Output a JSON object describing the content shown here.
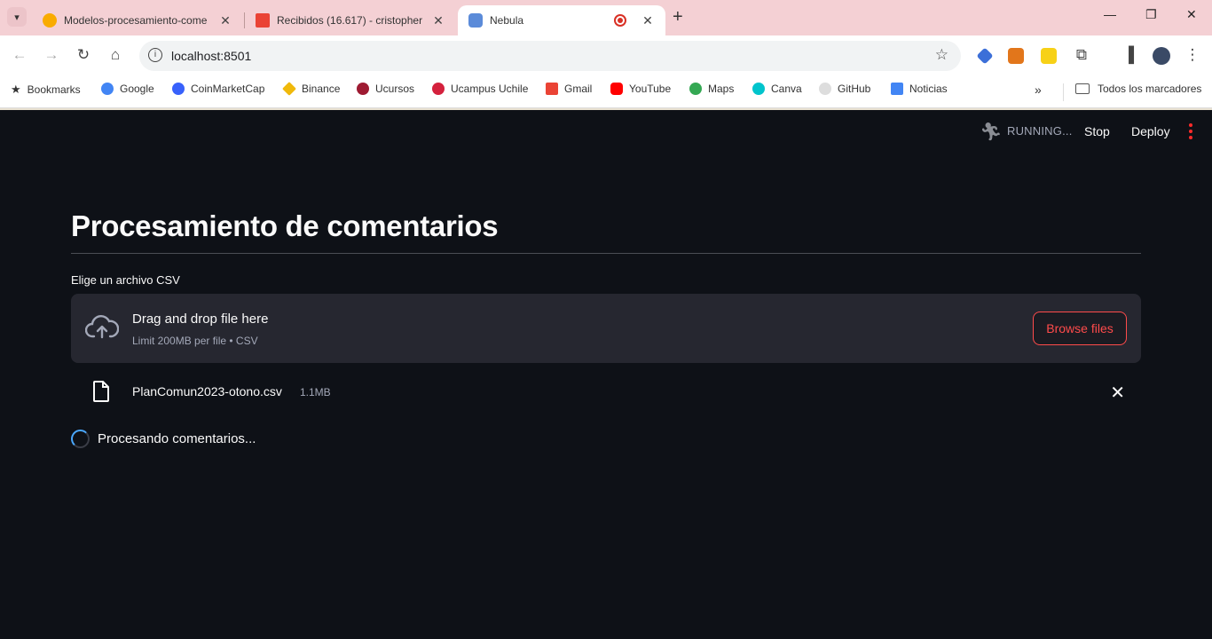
{
  "browser": {
    "tabs": [
      {
        "title": "Modelos-procesamiento-come",
        "favicon": "colab-icon"
      },
      {
        "title": "Recibidos (16.617) - cristopher",
        "favicon": "gmail-icon"
      },
      {
        "title": "Nebula",
        "favicon": "nebula-icon",
        "active": true
      }
    ],
    "url": "localhost:8501",
    "bookmarks": [
      {
        "label": "Bookmarks",
        "color": "#202124"
      },
      {
        "label": "Google",
        "color": "#4285f4"
      },
      {
        "label": "CoinMarketCap",
        "color": "#3861fb"
      },
      {
        "label": "Binance",
        "color": "#f0b90b"
      },
      {
        "label": "Ucursos",
        "color": "#9e1b32"
      },
      {
        "label": "Ucampus Uchile",
        "color": "#d4213d"
      },
      {
        "label": "Gmail",
        "color": "#ea4335"
      },
      {
        "label": "YouTube",
        "color": "#ff0000"
      },
      {
        "label": "Maps",
        "color": "#34a853"
      },
      {
        "label": "Canva",
        "color": "#00c4cc"
      },
      {
        "label": "GitHub",
        "color": "#cccccc"
      },
      {
        "label": "Noticias",
        "color": "#4285f4"
      }
    ],
    "all_bookmarks_label": "Todos los marcadores"
  },
  "header": {
    "status": "RUNNING...",
    "stop_label": "Stop",
    "deploy_label": "Deploy"
  },
  "main": {
    "title": "Procesamiento de comentarios",
    "uploader": {
      "label": "Elige un archivo CSV",
      "drop_text": "Drag and drop file here",
      "limit_text": "Limit 200MB per file • CSV",
      "browse_label": "Browse files"
    },
    "file": {
      "name": "PlanComun2023-otono.csv",
      "size": "1.1MB"
    },
    "status_message": "Procesando comentarios..."
  },
  "colors": {
    "background": "#0e1117",
    "surface": "#262730",
    "accent": "#ff4b4b",
    "text": "#fafafa",
    "muted": "#a3a8b8"
  }
}
